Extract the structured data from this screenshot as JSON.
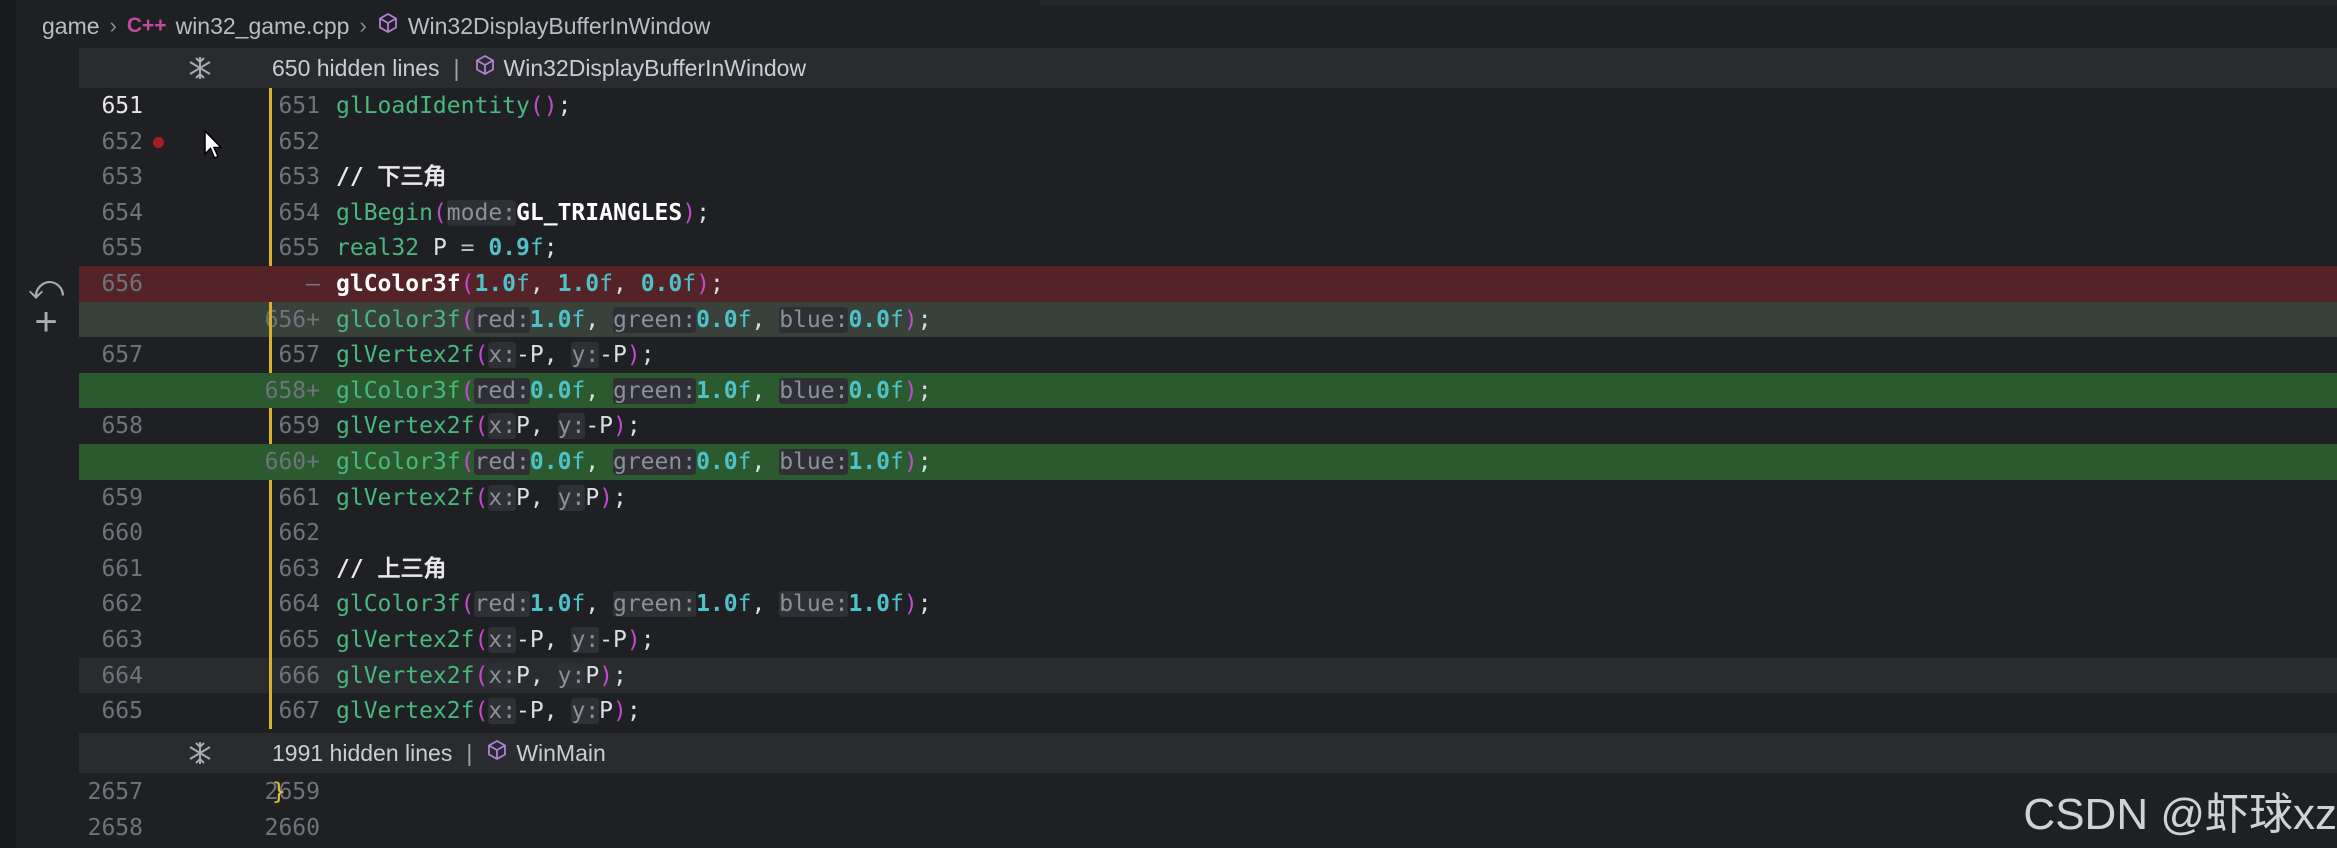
{
  "breadcrumb": {
    "root": "game",
    "lang_badge": "C++",
    "file": "win32_game.cpp",
    "symbol": "Win32DisplayBufferInWindow"
  },
  "folds": [
    {
      "label": "650 hidden lines",
      "symbol": "Win32DisplayBufferInWindow"
    },
    {
      "label": "1991 hidden lines",
      "symbol": "WinMain"
    }
  ],
  "lines": [
    {
      "old": "651",
      "new": "651"
    },
    {
      "old": "652",
      "new": "652"
    },
    {
      "old": "653",
      "new": "653"
    },
    {
      "old": "654",
      "new": "654"
    },
    {
      "old": "655",
      "new": "655"
    },
    {
      "old": "656",
      "new": "—"
    },
    {
      "old": "",
      "new": "656+"
    },
    {
      "old": "657",
      "new": "657"
    },
    {
      "old": "",
      "new": "658+"
    },
    {
      "old": "658",
      "new": "659"
    },
    {
      "old": "",
      "new": "660+"
    },
    {
      "old": "659",
      "new": "661"
    },
    {
      "old": "660",
      "new": "662"
    },
    {
      "old": "661",
      "new": "663"
    },
    {
      "old": "662",
      "new": "664"
    },
    {
      "old": "663",
      "new": "665"
    },
    {
      "old": "664",
      "new": "666"
    },
    {
      "old": "665",
      "new": "667"
    },
    {
      "old": "2657",
      "new": "2659"
    },
    {
      "old": "2658",
      "new": "2660"
    }
  ],
  "code": {
    "c1_fn": "glLoadIdentity",
    "c1_open": "(",
    "c1_close": ")",
    "c1_semi": ";",
    "c3_comment": "// 下三角",
    "c4_fn": "glBegin",
    "c4_open": "(",
    "c4_hint": "mode:",
    "c4_arg": "GL_TRIANGLES",
    "c4_close": ")",
    "c4_semi": ";",
    "c5_type": "real32",
    "c5_var": " P ",
    "c5_eq": "=",
    "c5_num": " 0.9",
    "c5_f": "f",
    "c5_semi": ";",
    "c6_fn": "glColor3f",
    "c6_open": "(",
    "c6_a": "1.0",
    "c6_af": "f",
    "c6_sep1": ", ",
    "c6_b": "1.0",
    "c6_bf": "f",
    "c6_sep2": ", ",
    "c6_c": "0.0",
    "c6_cf": "f",
    "c6_close": ")",
    "c6_semi": ";",
    "c7": {
      "fn": "glColor3f",
      "h1": "red:",
      "v1": "1.0",
      "h2": "green:",
      "v2": "0.0",
      "h3": "blue:",
      "v3": "0.0"
    },
    "c8": {
      "fn": "glVertex2f",
      "h1": "x:",
      "v1": "-P",
      "h2": "y:",
      "v2": "-P"
    },
    "c9": {
      "fn": "glColor3f",
      "h1": "red:",
      "v1": "0.0",
      "h2": "green:",
      "v2": "1.0",
      "h3": "blue:",
      "v3": "0.0"
    },
    "c10": {
      "fn": "glVertex2f",
      "h1": "x:",
      "v1": "P",
      "h2": "y:",
      "v2": "-P"
    },
    "c11": {
      "fn": "glColor3f",
      "h1": "red:",
      "v1": "0.0",
      "h2": "green:",
      "v2": "0.0",
      "h3": "blue:",
      "v3": "1.0"
    },
    "c12": {
      "fn": "glVertex2f",
      "h1": "x:",
      "v1": "P",
      "h2": "y:",
      "v2": "P"
    },
    "c14_comment": "// 上三角",
    "c15": {
      "fn": "glColor3f",
      "h1": "red:",
      "v1": "1.0",
      "h2": "green:",
      "v2": "1.0",
      "h3": "blue:",
      "v3": "1.0"
    },
    "c16": {
      "fn": "glVertex2f",
      "h1": "x:",
      "v1": "-P",
      "h2": "y:",
      "v2": "-P"
    },
    "c17": {
      "fn": "glVertex2f",
      "h1": "x:",
      "v1": "P",
      "h2": "y:",
      "v2": "P"
    },
    "c18": {
      "fn": "glVertex2f",
      "h1": "x:",
      "v1": "-P",
      "h2": "y:",
      "v2": "P"
    },
    "c19_brace": "}",
    "fsuffix": "f",
    "comma": ", ",
    "open": "(",
    "close": ")",
    "semi": ";"
  },
  "watermark": "CSDN @虾球xz",
  "colors": {
    "deleted_line": "#532328",
    "added_line": "#2c5a2f",
    "modified_bar": "#d9b327",
    "breakpoint": "#a51e22"
  },
  "icons": [
    "cpp-icon",
    "cube-icon",
    "fold-icon",
    "revert-icon",
    "plus-icon",
    "breakpoint-icon"
  ]
}
